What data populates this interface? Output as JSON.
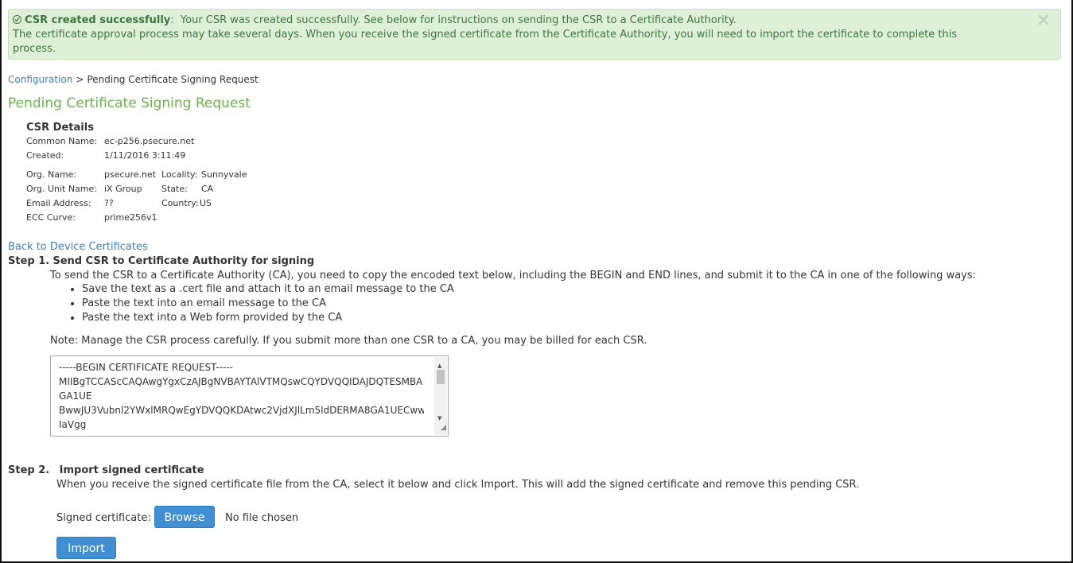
{
  "alert": {
    "title": "CSR created successfully",
    "colon": ":",
    "message_line1": "Your CSR was created successfully. See below for instructions on sending the CSR to a Certificate Authority.",
    "message_line2": "The certificate approval process may take several days. When you receive the signed certificate from the Certificate Authority, you will need to import the certificate to complete this",
    "message_line3": "process.",
    "close_icon": "close-icon",
    "icon": "check-circle-icon"
  },
  "breadcrumb": {
    "parent": "Configuration",
    "separator": ">",
    "current": "Pending Certificate Signing Request"
  },
  "page_title": "Pending Certificate Signing Request",
  "csr_details": {
    "heading": "CSR Details",
    "common_name_label": "Common Name:",
    "common_name": "ec-p256.psecure.net",
    "created_label": "Created:",
    "created": "1/11/2016 3:11:49",
    "org_name_label": "Org. Name:",
    "org_name": "psecure.net",
    "locality_label": "Locality:",
    "locality": "Sunnyvale",
    "org_unit_label": "Org. Unit Name:",
    "org_unit": "iX Group",
    "state_label": "State:",
    "state": "CA",
    "email_label": "Email Address:",
    "email": "??",
    "country_label": "Country:",
    "country": "US",
    "ecc_label": "ECC Curve:",
    "ecc": "prime256v1"
  },
  "back_link": "Back to Device Certificates",
  "step1": {
    "number": "Step 1.",
    "title": "Send CSR to Certificate Authority for signing",
    "intro": "To send the CSR to a Certificate Authority (CA), you need to copy the encoded text below, including the BEGIN and END lines, and submit it to the CA in one of the following ways:",
    "ways": [
      "Save the text as a .cert file and attach it to an email message to the CA",
      "Paste the text into an email message to the CA",
      "Paste the text into a Web form provided by the CA"
    ],
    "note": "Note: Manage the CSR process carefully. If you submit more than one CSR to a CA, you may be billed for each CSR.",
    "csr_lines": [
      "-----BEGIN CERTIFICATE REQUEST-----",
      "MIIBgTCCASсCAQAwgYgxCzAJBgNVBAYTAlVTMQswCQYDVQQIDAJDQTESMBA",
      "GA1UE",
      "BwwJU3Vubnl2YWxlMRQwEgYDVQQKDAtwc2VjdXJlLm5ldDERMA8GA1UECww",
      "IaVgg"
    ]
  },
  "step2": {
    "number": "Step 2.",
    "title": "Import signed certificate",
    "intro": "When you receive the signed certificate file from the CA, select it below and click Import. This will add the signed certificate and remove this pending CSR.",
    "file_label": "Signed certificate:",
    "browse_label": "Browse",
    "no_file": "No file chosen",
    "import_label": "Import"
  }
}
